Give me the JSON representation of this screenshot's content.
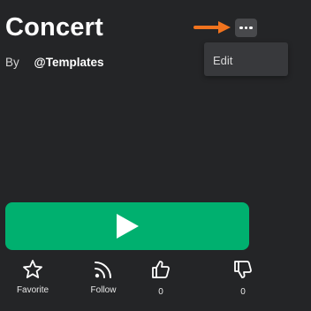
{
  "experience": {
    "title": "Concert",
    "by_label": "By",
    "creator": "@Templates"
  },
  "more_menu": {
    "icon": "more-horizontal-icon",
    "items": [
      {
        "label": "Edit"
      }
    ]
  },
  "annotation": {
    "arrow_color": "#f0731e"
  },
  "play": {
    "icon": "play-icon",
    "color": "#00b06f"
  },
  "actions": {
    "favorite": {
      "icon": "star-icon",
      "label": "Favorite"
    },
    "follow": {
      "icon": "rss-icon",
      "label": "Follow"
    },
    "like": {
      "icon": "thumbs-up-icon",
      "count": "0"
    },
    "dislike": {
      "icon": "thumbs-down-icon",
      "count": "0"
    }
  }
}
